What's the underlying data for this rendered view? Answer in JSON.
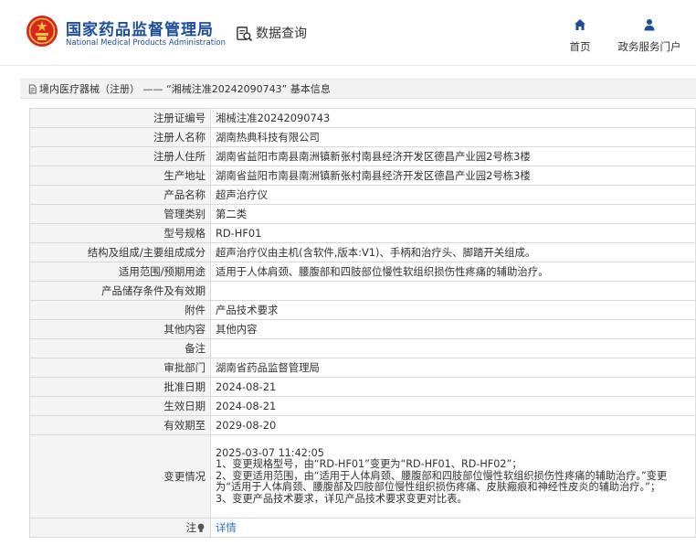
{
  "header": {
    "logo_cn": "国家药品监督管理局",
    "logo_en": "National Medical Products Administration",
    "data_query_label": "数据查询",
    "nav": [
      {
        "label": "首页",
        "icon": "home-icon"
      },
      {
        "label": "政务服务门户",
        "icon": "user-icon"
      }
    ],
    "brand_color": "#1c4e9a",
    "emblem_color": "#d7261e"
  },
  "breadcrumb": {
    "text": "境内医疗器械（注册） —— “湘械注准20242090743” 基本信息"
  },
  "table": {
    "rows": [
      {
        "label": "注册证编号",
        "value": "湘械注准20242090743"
      },
      {
        "label": "注册人名称",
        "value": "湖南热典科技有限公司"
      },
      {
        "label": "注册人住所",
        "value": "湖南省益阳市南县南洲镇新张村南县经济开发区德昌产业园2号栋3楼"
      },
      {
        "label": "生产地址",
        "value": "湖南省益阳市南县南洲镇新张村南县经济开发区德昌产业园2号栋3楼"
      },
      {
        "label": "产品名称",
        "value": "超声治疗仪"
      },
      {
        "label": "管理类别",
        "value": "第二类"
      },
      {
        "label": "型号规格",
        "value": "RD-HF01"
      },
      {
        "label": "结构及组成/主要组成成分",
        "value": "超声治疗仪由主机(含软件,版本:V1)、手柄和治疗头、脚踏开关组成。"
      },
      {
        "label": "适用范围/预期用途",
        "value": "适用于人体肩颈、腰腹部和四肢部位慢性软组织损伤性疼痛的辅助治疗。"
      },
      {
        "label": "产品储存条件及有效期",
        "value": ""
      },
      {
        "label": "附件",
        "value": "产品技术要求"
      },
      {
        "label": "其他内容",
        "value": "其他内容"
      },
      {
        "label": "备注",
        "value": ""
      },
      {
        "label": "审批部门",
        "value": "湖南省药品监督管理局"
      },
      {
        "label": "批准日期",
        "value": "2024-08-21"
      },
      {
        "label": "生效日期",
        "value": "2024-08-21"
      },
      {
        "label": "有效期至",
        "value": "2029-08-20"
      }
    ],
    "change": {
      "label": "变更情况",
      "lines": [
        "2025-03-07 11:42:05",
        "1、变更规格型号，由“RD-HF01”变更为“RD-HF01、RD-HF02”；",
        "2、变更适用范围，由“适用于人体肩颈、腰腹部和四肢部位慢性软组织损伤性疼痛的辅助治疗。”变更为“适用于人体肩颈、腰腹部及四肢部位慢性组织损伤疼痛、皮肤瘢痕和神经性皮炎的辅助治疗。”；",
        "3、变更产品技术要求，详见产品技术要求变更对比表。"
      ]
    },
    "tip": {
      "label": "注",
      "link_text": "详情"
    }
  }
}
